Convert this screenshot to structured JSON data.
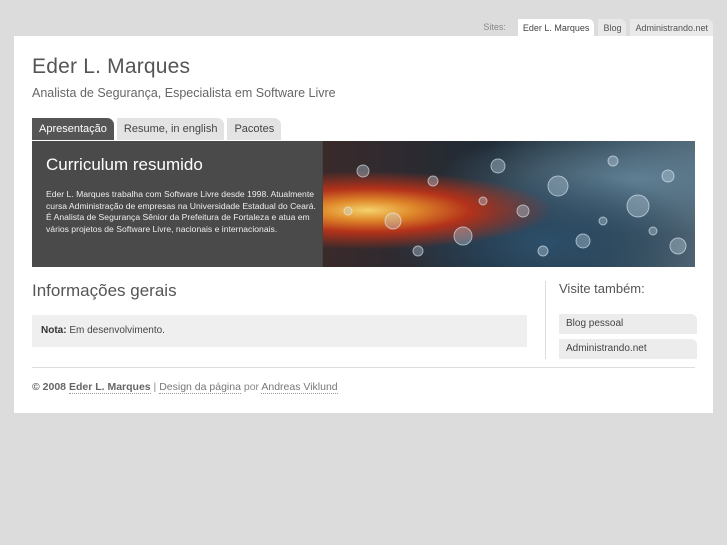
{
  "sites": {
    "label": "Sites:",
    "tabs": [
      "Eder L. Marques",
      "Blog",
      "Administrando.net"
    ]
  },
  "header": {
    "title": "Eder L. Marques",
    "subtitle": "Analista de Segurança, Especialista em Software Livre"
  },
  "nav": {
    "tabs": [
      "Apresentação",
      "Resume, in english",
      "Pacotes"
    ]
  },
  "hero": {
    "title": "Curriculum resumido",
    "body": "Eder L. Marques trabalha com Software Livre desde 1998. Atualmente cursa Administração de empresas na Universidade Estadual do Ceará. É Analista de Segurança Sênior da Prefeitura de Fortaleza e atua em vários projetos de Software Livre, nacionais e internacionais."
  },
  "main": {
    "heading": "Informações gerais",
    "note_label": "Nota:",
    "note_text": " Em desenvolvimento."
  },
  "sidebar": {
    "heading": "Visite também:",
    "links": [
      "Blog pessoal",
      "Administrando.net"
    ]
  },
  "footer": {
    "copyright": "© 2008",
    "author": "Eder L. Marques",
    "separator": " | ",
    "design_label": "Design da página",
    "by": " por ",
    "designer": "Andreas Viklund"
  },
  "colors": {
    "background": "#dcdcdc",
    "page": "#ffffff",
    "active_tab": "#555555",
    "hero_panel": "#4a4a4a"
  }
}
